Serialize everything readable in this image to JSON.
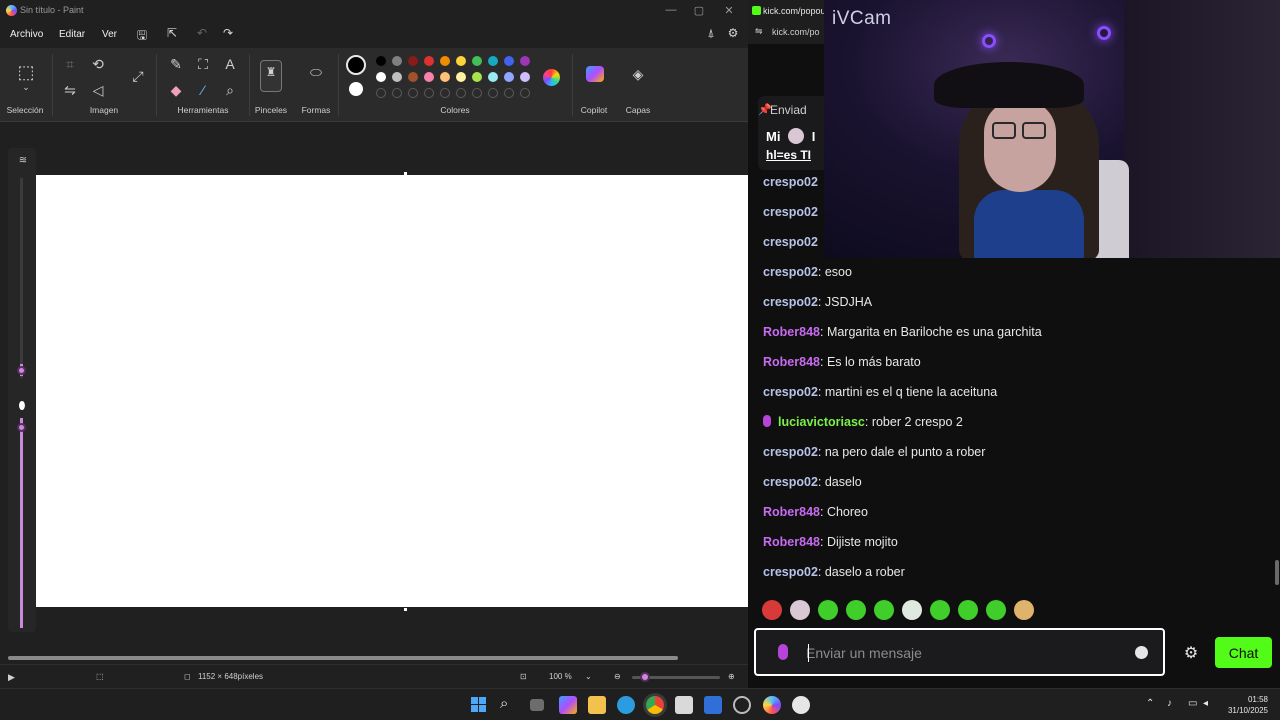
{
  "paint": {
    "window_title": "Sin título - Paint",
    "window_controls": {
      "minimize": "—",
      "maximize": "▢",
      "close": "✕"
    },
    "menu": [
      "Archivo",
      "Editar",
      "Ver"
    ],
    "quick_access_icons": [
      "save-icon",
      "share-icon",
      "undo-icon",
      "redo-icon",
      "profile-icon",
      "settings-icon"
    ],
    "ribbon": {
      "groups": {
        "selection": "Selección",
        "image": "Imagen",
        "tools": "Herramientas",
        "brushes": "Pinceles",
        "shapes": "Formas",
        "colors": "Colores",
        "copilot": "Copilot",
        "layers": "Capas"
      },
      "primary_color": "#000000",
      "secondary_color": "#ffffff",
      "palette_row1": [
        "#000000",
        "#808080",
        "#8b1a1a",
        "#e03131",
        "#f08c00",
        "#ffd43b",
        "#40c057",
        "#15aabf",
        "#4263eb",
        "#9c36b5"
      ],
      "palette_row2": [
        "#ffffff",
        "#bfbfbf",
        "#a0522d",
        "#f783ac",
        "#ffc078",
        "#fff3a0",
        "#a9e34b",
        "#99e9f2",
        "#91a7ff",
        "#d0bfff"
      ]
    },
    "status": {
      "canvas_size": "1152 × 648píxeles",
      "zoom": "100 %",
      "zoom_level": 0.15
    }
  },
  "chat": {
    "tab_title": "kick.com/popout",
    "url": "kick.com/po",
    "pinned": {
      "label": "Enviad",
      "line1": "Mi",
      "line1_suffix": "I",
      "line2": "hl=es TI"
    },
    "partial_users": [
      "crespo02",
      "crespo02",
      "crespo02"
    ],
    "messages": [
      {
        "user": "crespo02",
        "color": "#b7c3e8",
        "text": "esoo",
        "mic": false
      },
      {
        "user": "crespo02",
        "color": "#b7c3e8",
        "text": "JSDJHA",
        "mic": false
      },
      {
        "user": "Rober848",
        "color": "#c86bf0",
        "text": "Margarita en Bariloche es una garchita",
        "mic": false
      },
      {
        "user": "Rober848",
        "color": "#c86bf0",
        "text": "Es lo más barato",
        "mic": false
      },
      {
        "user": "crespo02",
        "color": "#b7c3e8",
        "text": "martini es el q tiene la aceituna",
        "mic": false
      },
      {
        "user": "luciavictoriasc",
        "color": "#7cf04a",
        "text": "rober 2 crespo 2",
        "mic": true
      },
      {
        "user": "crespo02",
        "color": "#b7c3e8",
        "text": "na pero dale el punto a rober",
        "mic": false
      },
      {
        "user": "crespo02",
        "color": "#b7c3e8",
        "text": "daselo",
        "mic": false
      },
      {
        "user": "Rober848",
        "color": "#c86bf0",
        "text": "Choreo",
        "mic": false
      },
      {
        "user": "Rober848",
        "color": "#c86bf0",
        "text": "Dijiste mojito",
        "mic": false
      },
      {
        "user": "crespo02",
        "color": "#b7c3e8",
        "text": "daselo a rober",
        "mic": false
      }
    ],
    "input_placeholder": "Enviar un mensaje",
    "chat_button": "Chat"
  },
  "webcam": {
    "label": "iVCam"
  },
  "taskbar": {
    "time": "01:58",
    "date": "31/10/2025"
  }
}
